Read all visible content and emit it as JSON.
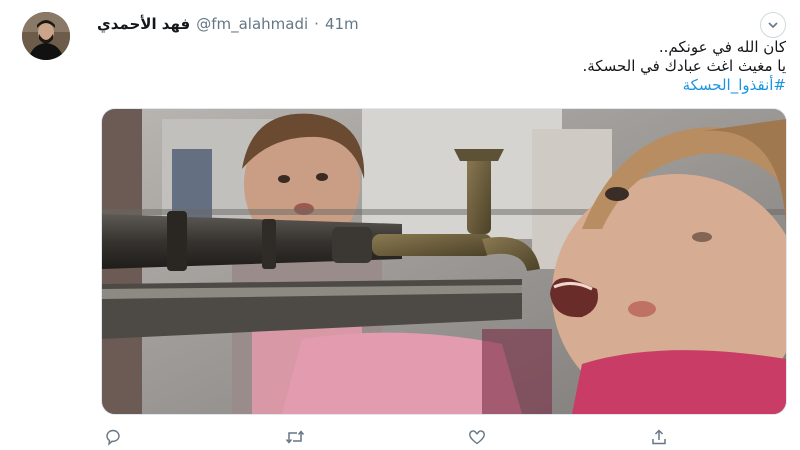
{
  "tweet": {
    "author": {
      "display_name": "فهد الأحمدي",
      "handle": "@fm_alahmadi",
      "separator": "·",
      "time": "41m"
    },
    "text": {
      "line1": "كان الله في عونكم..",
      "line2": "يا مغيث اغث عبادك في الحسكة.",
      "hashtag": "#أنقذوا_الحسكة"
    },
    "icons": {
      "menu": "chevron-down-icon",
      "reply": "reply-icon",
      "retweet": "retweet-icon",
      "like": "heart-icon",
      "share": "share-icon"
    },
    "colors": {
      "link": "#1b95e0",
      "muted": "#657786",
      "text": "#14171a"
    }
  }
}
